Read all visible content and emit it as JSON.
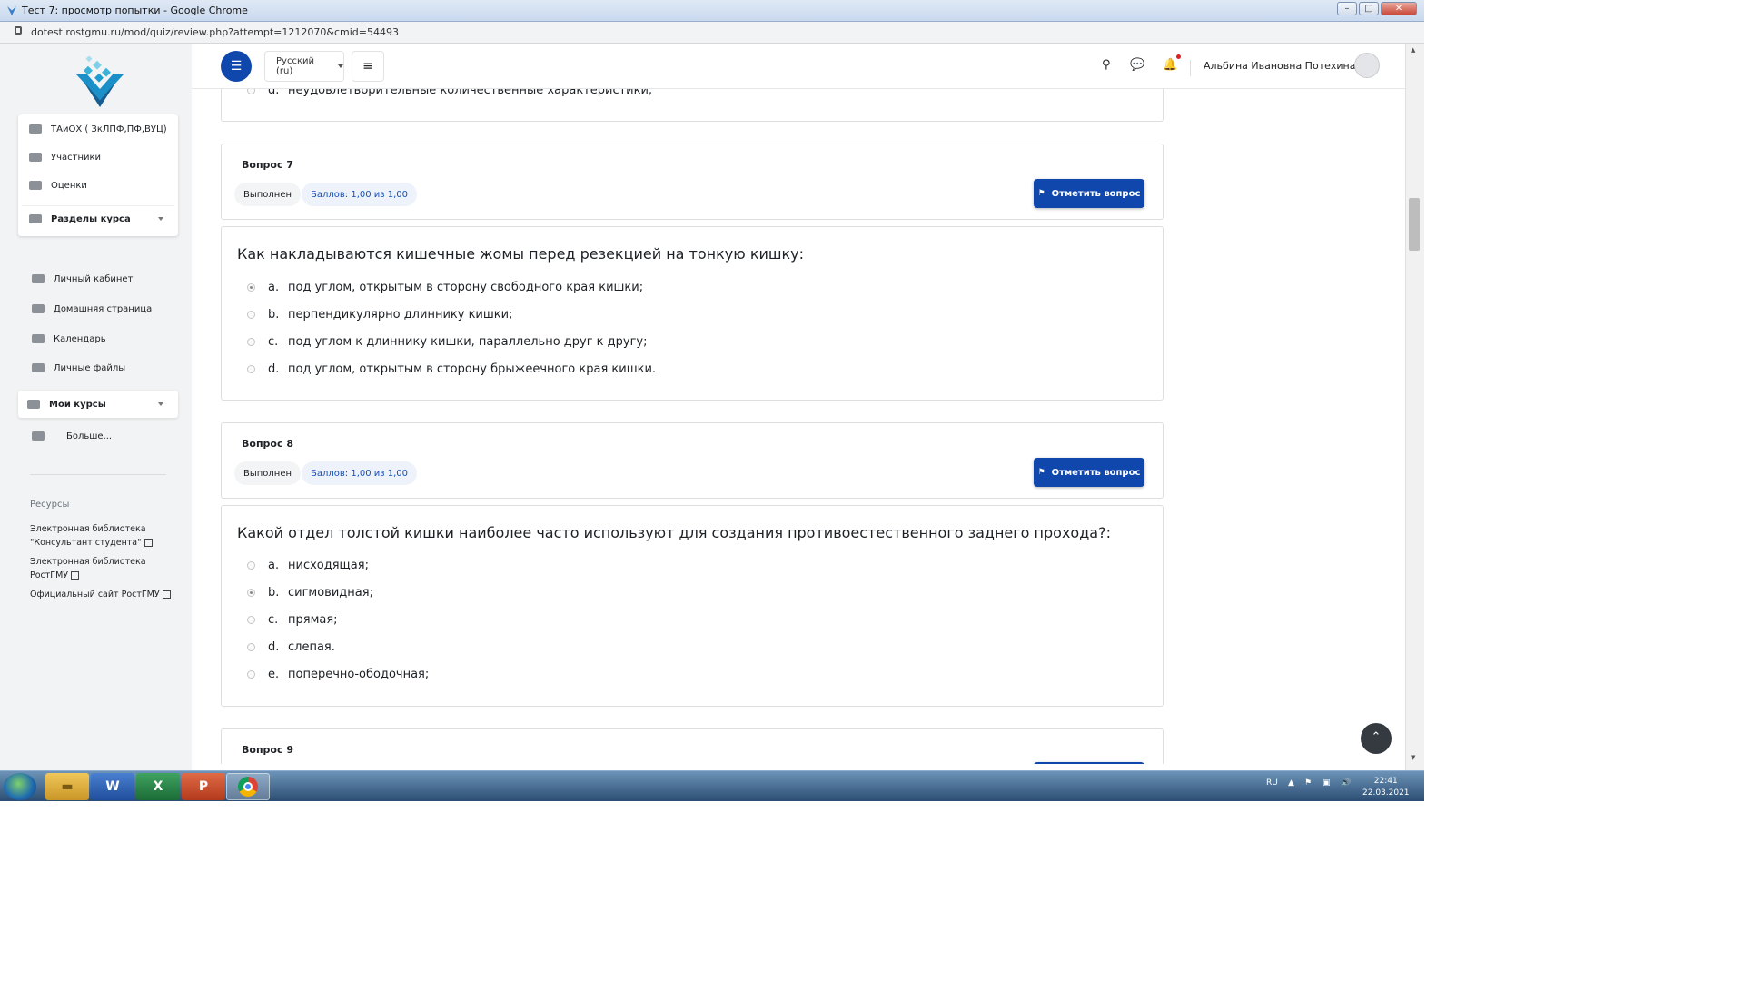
{
  "window": {
    "title": "Тест 7: просмотр попытки - Google Chrome",
    "url": "dotest.rostgmu.ru/mod/quiz/review.php?attempt=1212070&cmid=54493"
  },
  "sidebar": {
    "course_items": [
      {
        "label": "ТАиОХ ( ЗкЛПФ,ПФ,ВУЦ)",
        "icon": "graduation-cap-icon"
      },
      {
        "label": "Участники",
        "icon": "users-icon"
      },
      {
        "label": "Оценки",
        "icon": "book-icon"
      },
      {
        "label": "Разделы курса",
        "icon": "list-icon"
      }
    ],
    "nav_items": [
      {
        "label": "Личный кабинет",
        "icon": "dashboard-icon"
      },
      {
        "label": "Домашняя страница",
        "icon": "home-icon"
      },
      {
        "label": "Календарь",
        "icon": "calendar-icon"
      },
      {
        "label": "Личные файлы",
        "icon": "drive-icon"
      }
    ],
    "my_courses": "Мои курсы",
    "more": "Больше...",
    "resources_title": "Ресурсы",
    "resources": [
      {
        "line1": "Электронная библиотека",
        "line2": "\"Консультант студента\""
      },
      {
        "line1": "Электронная библиотека",
        "line2": "РостГМУ"
      },
      {
        "line1": "Официальный сайт РостГМУ",
        "line2": ""
      }
    ]
  },
  "header": {
    "language": "Русский (ru)",
    "user": "Альбина Ивановна Потехина"
  },
  "top_partial_answer": {
    "letter": "d.",
    "text": "неудовлетворительные количественные характеристики;"
  },
  "questions": [
    {
      "number": "Вопрос 7",
      "state": "Выполнен",
      "grade": "Баллов: 1,00 из 1,00",
      "flag": "Отметить вопрос",
      "text": "Как накладываются кишечные жомы перед резекцией на тонкую кишку:",
      "answers": [
        {
          "letter": "a.",
          "text": "под углом, открытым в сторону свободного края кишки;",
          "selected": true
        },
        {
          "letter": "b.",
          "text": "перпендикулярно длиннику кишки;",
          "selected": false
        },
        {
          "letter": "c.",
          "text": "под углом к длиннику кишки, параллельно друг к другу;",
          "selected": false
        },
        {
          "letter": "d.",
          "text": "под углом, открытым в сторону брыжеечного края кишки.",
          "selected": false
        }
      ]
    },
    {
      "number": "Вопрос 8",
      "state": "Выполнен",
      "grade": "Баллов: 1,00 из 1,00",
      "flag": "Отметить вопрос",
      "text": "Какой отдел толстой кишки наиболее часто используют для создания противоестественного заднего прохода?:",
      "answers": [
        {
          "letter": "a.",
          "text": "нисходящая;",
          "selected": false
        },
        {
          "letter": "b.",
          "text": "сигмовидная;",
          "selected": true
        },
        {
          "letter": "c.",
          "text": "прямая;",
          "selected": false
        },
        {
          "letter": "d.",
          "text": "слепая.",
          "selected": false
        },
        {
          "letter": "e.",
          "text": "поперечно-ободочная;",
          "selected": false
        }
      ]
    },
    {
      "number": "Вопрос 9"
    }
  ],
  "taskbar": {
    "lang": "RU",
    "time": "22:41",
    "date": "22.03.2021"
  }
}
